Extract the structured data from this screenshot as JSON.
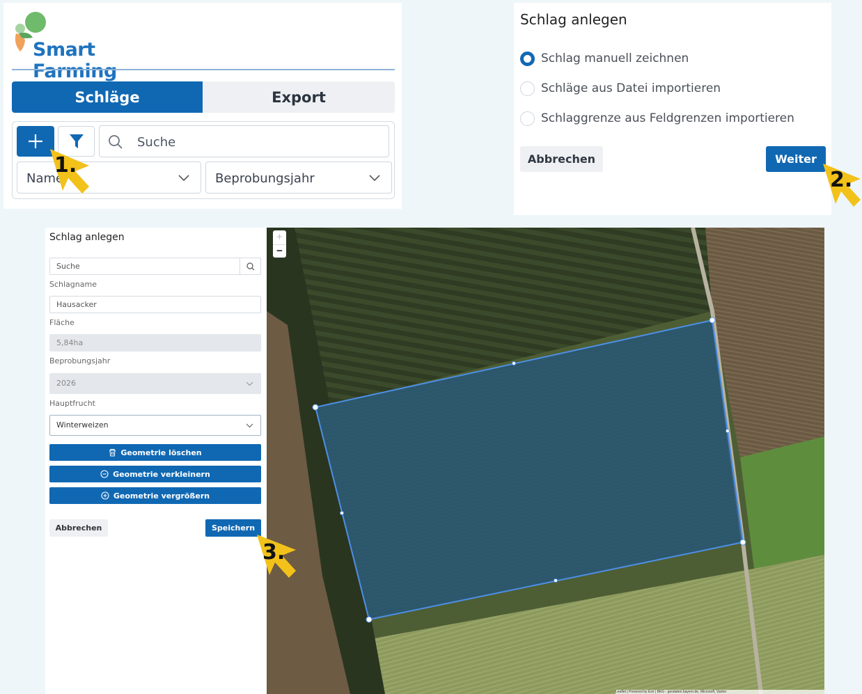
{
  "colors": {
    "primary": "#1068b3",
    "secondary_bg": "#eef0f3",
    "arrow": "#f2c21b",
    "polygon_fill": "#1f4c78",
    "polygon_stroke": "#4d8fe6"
  },
  "panel1": {
    "logo_text": "Smart Farming",
    "tabs": [
      "Schläge",
      "Export"
    ],
    "active_tab": "Schläge",
    "add_icon": "plus-icon",
    "filter_icon": "filter-icon",
    "search_placeholder": "Suche",
    "select_name": "Name",
    "select_year": "Beprobungsjahr"
  },
  "panel2": {
    "title": "Schlag anlegen",
    "options": [
      {
        "label": "Schlag manuell zeichnen",
        "selected": true
      },
      {
        "label": "Schläge aus Datei importieren",
        "selected": false
      },
      {
        "label": "Schlaggrenze aus Feldgrenzen importieren",
        "selected": false
      }
    ],
    "cancel": "Abbrechen",
    "next": "Weiter"
  },
  "panel3": {
    "title": "Schlag anlegen",
    "search_placeholder": "Suche",
    "name_label": "Schlagname",
    "name_value": "Hausacker",
    "area_label": "Fläche",
    "area_value": "5,84ha",
    "year_label": "Beprobungsjahr",
    "year_value": "2026",
    "crop_label": "Hauptfrucht",
    "crop_value": "Winterweizen",
    "btn_delete": "Geometrie löschen",
    "btn_shrink": "Geometrie verkleinern",
    "btn_grow": "Geometrie vergrößern",
    "cancel": "Abbrechen",
    "save": "Speichern",
    "map": {
      "zoom_in": "+",
      "zoom_out": "−",
      "attribution": "Leaflet | Powered by Esri | BKG - geodaten.bayern.de, Microsoft, Vantor"
    }
  },
  "steps": [
    "1.",
    "2.",
    "3."
  ]
}
